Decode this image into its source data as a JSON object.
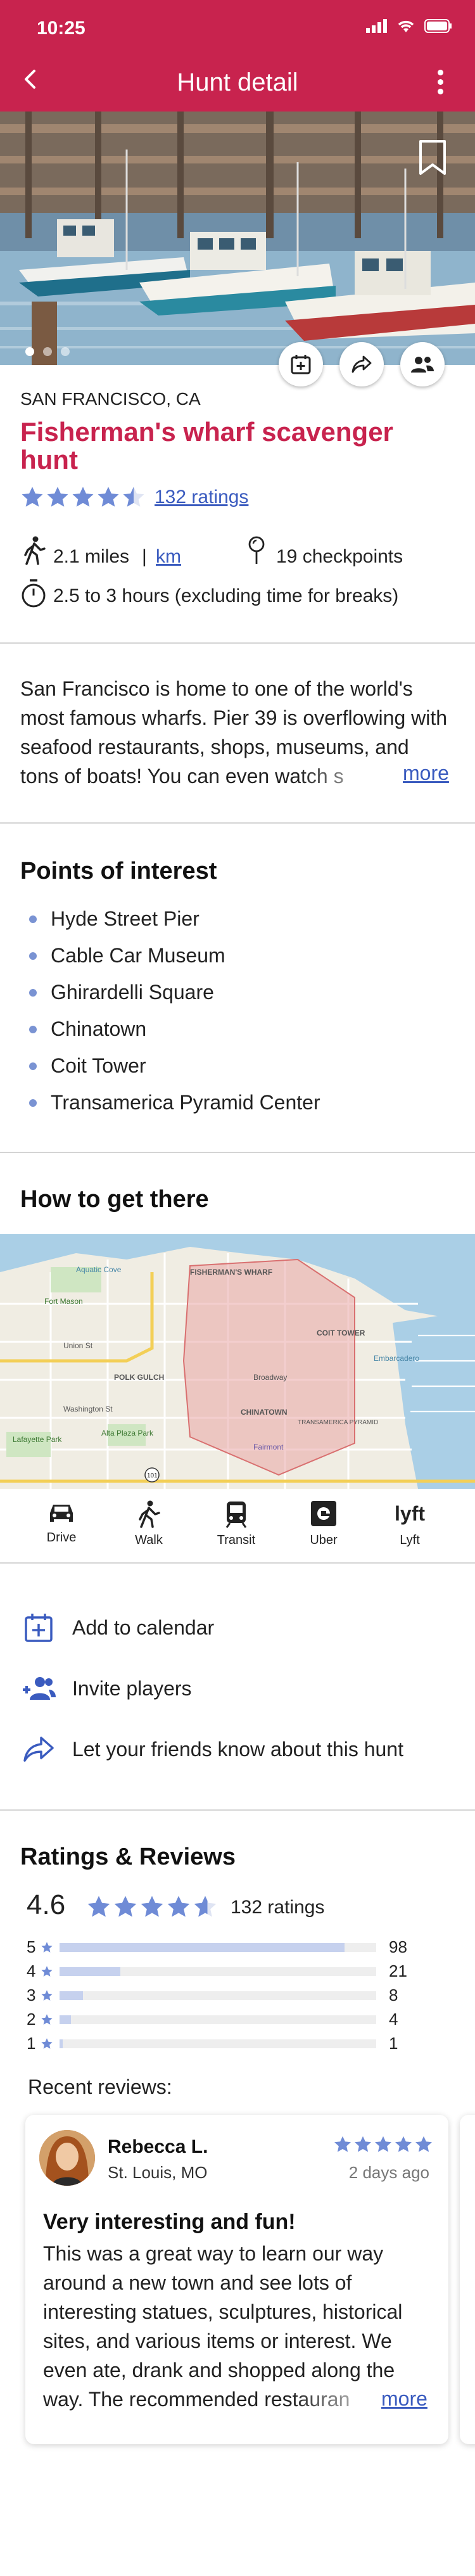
{
  "status_bar": {
    "time": "10:25"
  },
  "header": {
    "title": "Hunt detail"
  },
  "hunt": {
    "city": "SAN FRANCISCO, CA",
    "title": "Fisherman's wharf scavenger hunt",
    "star_rating": 4.5,
    "ratings_link": "132 ratings",
    "distance": "2.1 miles",
    "distance_unit": "km",
    "checkpoints": "19 checkpoints",
    "duration": "2.5 to 3 hours (excluding time for breaks)",
    "description": "San Francisco is home to one of the world's most famous wharfs. Pier 39 is overflowing with seafood restaurants, shops, museums, and tons of boats! You can even watch s",
    "more_label": "more"
  },
  "points_of_interest": {
    "heading": "Points of interest",
    "items": [
      "Hyde Street Pier",
      "Cable Car Museum",
      "Ghirardelli Square",
      "Chinatown",
      "Coit Tower",
      "Transamerica Pyramid Center"
    ]
  },
  "directions": {
    "heading": "How to get there",
    "map_labels": {
      "wharf": "FISHERMAN'S WHARF",
      "coit": "COIT TOWER",
      "chinatown": "CHINATOWN",
      "polk": "POLK GULCH",
      "transamerica": "TRANSAMERICA PYRAMID",
      "fort_mason": "Fort Mason",
      "aquatic": "Aquatic Cove",
      "lafayette": "Lafayette Park",
      "alta": "Alta Plaza Park",
      "fairmont": "Fairmont",
      "broadway": "Broadway",
      "washington": "Washington St",
      "union": "Union St",
      "embarcadero": "Embarcadero",
      "highway": "101"
    },
    "options": [
      "Drive",
      "Walk",
      "Transit",
      "Uber",
      "Lyft"
    ]
  },
  "actions": {
    "calendar": "Add to calendar",
    "invite": "Invite players",
    "share": "Let your friends know about this hunt"
  },
  "ratings": {
    "heading": "Ratings & Reviews",
    "average": "4.6",
    "average_stars": 4.6,
    "count_label": "132 ratings",
    "distribution": [
      {
        "stars": "5",
        "count": "98",
        "value": 98
      },
      {
        "stars": "4",
        "count": "21",
        "value": 21
      },
      {
        "stars": "3",
        "count": "8",
        "value": 8
      },
      {
        "stars": "2",
        "count": "4",
        "value": 4
      },
      {
        "stars": "1",
        "count": "1",
        "value": 1
      }
    ],
    "recent_label": "Recent reviews:"
  },
  "review": {
    "name": "Rebecca L.",
    "location": "St. Louis, MO",
    "date": "2 days ago",
    "stars": 5,
    "title": "Very interesting and fun!",
    "body": "This was a great way to learn our way around a new town and see lots of interesting statues, sculptures, historical sites, and various items or interest. We even ate, drank and shopped along the way. The recommended restauran",
    "more_label": "more"
  },
  "colors": {
    "brand": "#c8234e",
    "accent": "#3a5bbf",
    "star": "#6f8bd6"
  }
}
